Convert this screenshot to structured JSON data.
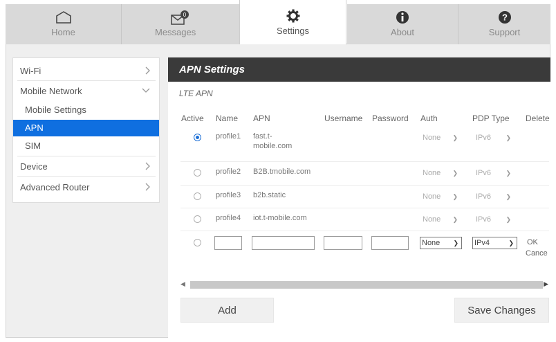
{
  "tabs": [
    {
      "label": "Home",
      "icon": "home-icon"
    },
    {
      "label": "Messages",
      "icon": "envelope-icon",
      "badge": "0"
    },
    {
      "label": "Settings",
      "icon": "gear-icon",
      "active": true
    },
    {
      "label": "About",
      "icon": "info-icon"
    },
    {
      "label": "Support",
      "icon": "help-icon"
    }
  ],
  "sidebar": {
    "items": [
      {
        "label": "Wi-Fi"
      },
      {
        "label": "Mobile Network"
      },
      {
        "label": "Device"
      },
      {
        "label": "Advanced Router"
      }
    ],
    "sub_items": [
      {
        "label": "Mobile Settings"
      },
      {
        "label": "APN",
        "active": true
      },
      {
        "label": "SIM"
      }
    ]
  },
  "panel": {
    "title": "APN Settings",
    "section": "LTE APN",
    "columns": [
      "Active",
      "Name",
      "APN",
      "Username",
      "Password",
      "Auth",
      "PDP Type",
      "Delete"
    ],
    "rows": [
      {
        "active": true,
        "name": "profile1",
        "apn": "fast.t-mobile.com",
        "apn_line1": "fast.t-",
        "apn_line2": "mobile.com",
        "auth": "None",
        "pdp": "IPv6"
      },
      {
        "active": false,
        "name": "profile2",
        "apn": "B2B.tmobile.com",
        "auth": "None",
        "pdp": "IPv6"
      },
      {
        "active": false,
        "name": "profile3",
        "apn": "b2b.static",
        "auth": "None",
        "pdp": "IPv6"
      },
      {
        "active": false,
        "name": "profile4",
        "apn": "iot.t-mobile.com",
        "auth": "None",
        "pdp": "IPv6"
      }
    ],
    "new_row": {
      "auth": "None",
      "pdp": "IPv4",
      "ok_label": "OK",
      "cancel_label": "Cance"
    },
    "add_label": "Add",
    "save_label": "Save Changes"
  },
  "colors": {
    "accent": "#0f6fe0",
    "header_bg": "#3a3a3a",
    "tab_inactive": "#d9d9d9"
  }
}
